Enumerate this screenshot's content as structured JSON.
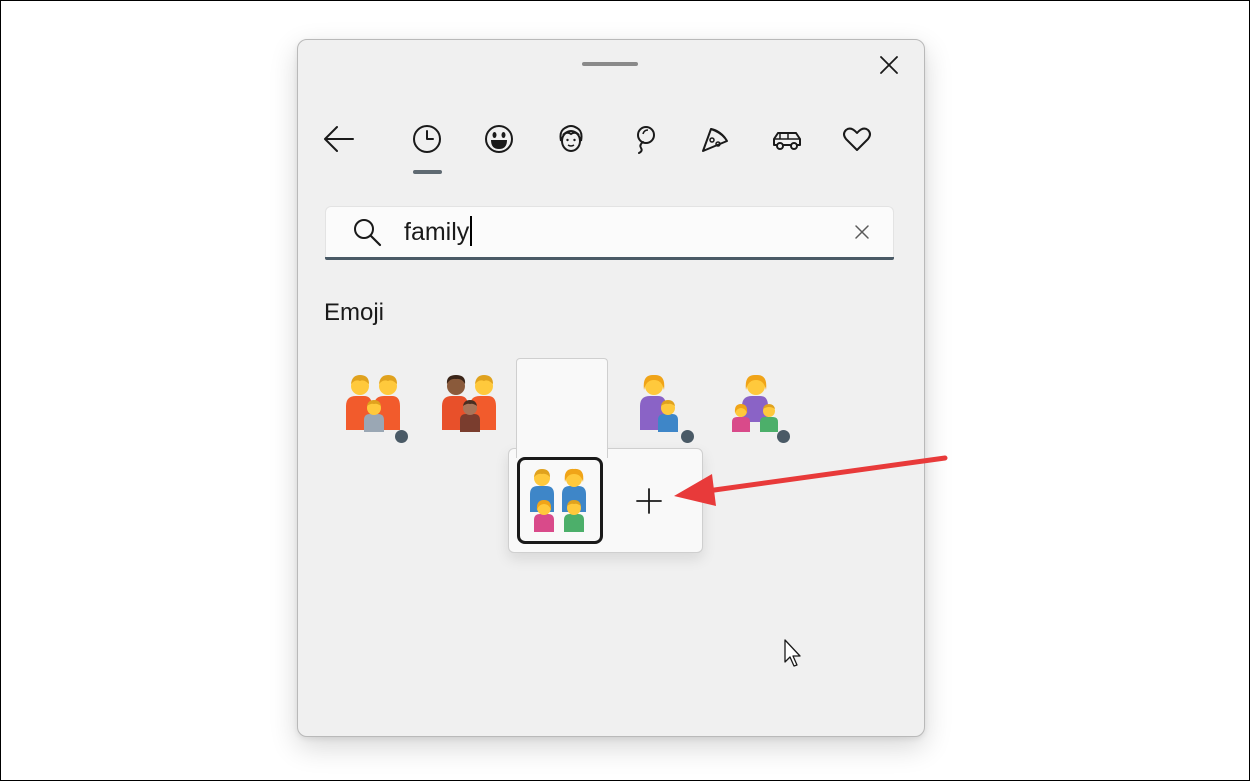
{
  "window": {
    "close_icon": "close-icon",
    "grip": "drag-handle"
  },
  "nav": {
    "back_icon": "arrow-left-icon",
    "tabs": [
      {
        "name": "recent",
        "icon": "clock-icon",
        "active": true
      },
      {
        "name": "smileys",
        "icon": "smiley-icon"
      },
      {
        "name": "people",
        "icon": "face-icon"
      },
      {
        "name": "celebration",
        "icon": "balloon-icon"
      },
      {
        "name": "food",
        "icon": "pizza-icon"
      },
      {
        "name": "travel",
        "icon": "car-icon"
      },
      {
        "name": "symbols",
        "icon": "heart-icon"
      }
    ]
  },
  "search": {
    "value": "family",
    "clear_icon": "clear-icon"
  },
  "section": {
    "title": "Emoji"
  },
  "emoji_results": [
    {
      "glyph": "👪",
      "has_variants": true
    },
    {
      "glyph": "👨🏾‍👨‍👦🏽",
      "has_variants": false
    },
    {
      "glyph": "👨‍👩‍👧‍👦",
      "has_variants": true,
      "expanded": true
    },
    {
      "glyph": "👩‍👦",
      "has_variants": true
    },
    {
      "glyph": "👩‍👧‍👦",
      "has_variants": true
    }
  ],
  "variant_flyout": {
    "selected_glyph": "👨‍👩‍👧‍👦",
    "add_icon": "plus-icon"
  },
  "colors": {
    "panel_bg": "#f0f0f0",
    "accent": "#4a5a66",
    "arrow": "#e83a3a"
  }
}
